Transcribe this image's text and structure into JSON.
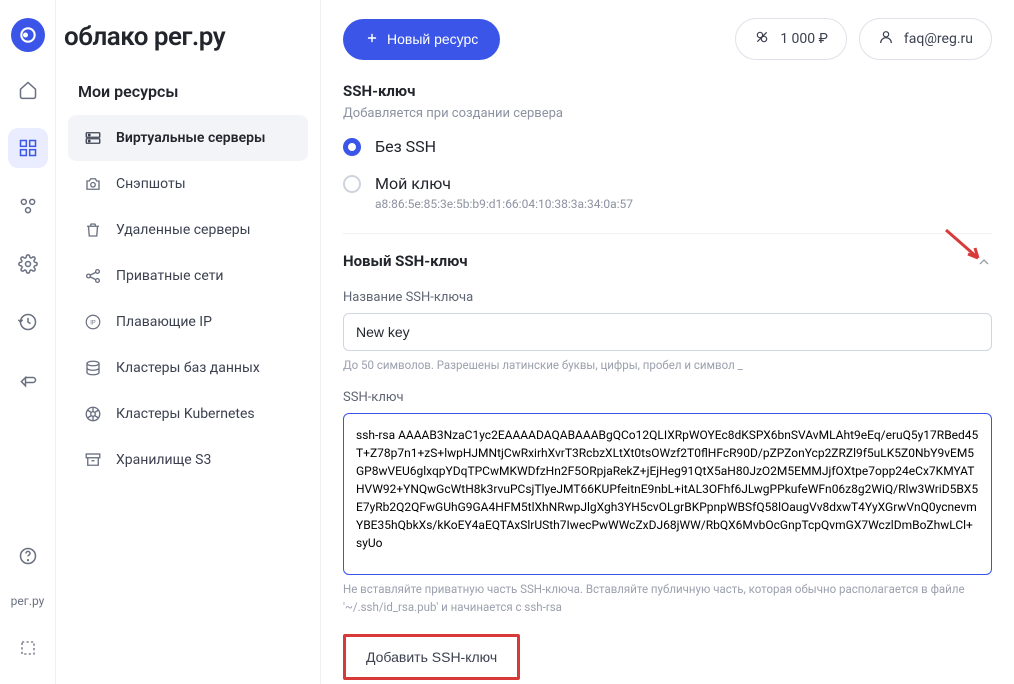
{
  "brand": "облако рег.ру",
  "section_title": "Мои ресурсы",
  "nav": {
    "servers": "Виртуальные серверы",
    "snapshots": "Снэпшоты",
    "deleted": "Удаленные серверы",
    "networks": "Приватные сети",
    "floating_ip": "Плавающие IP",
    "db": "Кластеры баз данных",
    "k8s": "Кластеры Kubernetes",
    "s3": "Хранилище S3"
  },
  "topbar": {
    "new_resource": "Новый ресурс",
    "balance": "1 000 ₽",
    "email": "faq@reg.ru"
  },
  "rail_footer": "рег.ру",
  "ssh": {
    "title": "SSH-ключ",
    "subtitle": "Добавляется при создании сервера",
    "option_none": "Без SSH",
    "option_mykey": "Мой ключ",
    "fingerprint": "a8:86:5e:85:3e:5b:b9:d1:66:04:10:38:3a:34:0a:57"
  },
  "new_key": {
    "heading": "Новый SSH-ключ",
    "name_label": "Название SSH-ключа",
    "name_value": "New key",
    "name_helper": "До 50 символов. Разрешены латинские буквы, цифры, пробел и символ _",
    "key_label": "SSH-ключ",
    "key_value": "ssh-rsa AAAAB3NzaC1yc2EAAAADAQABAAABgQCo12QLIXRpWOYEc8dKSPX6bnSVAvMLAht9eEq/eruQ5y17RBed45T+Z78p7n1+zS+lwpHJMNtjCwRxirhXvrT3RcbzXLtXt0tsOWzf2T0flHFcR90D/pZPZonYcp2ZRZl9f5uLK5Z0NbY9vEM5GP8wVEU6glxqpYDqTPCwMKWDfzHn2F5ORpjaRekZ+jEjHeg91QtX5aH80JzO2M5EMMJjfOXtpe7opp24eCx7KMYATHVW92+YNQwGcWtH8k3rvuPCsjTlyeJMT66KUPfeitnE9nbL+itAL3OFhf6JLwgPPkufeWFn06z8g2WiQ/Rlw3WriD5BX5E7yRb2Q2QFwGUhG9GA4HFM5tlXhNRwpJlgXgh3YH5cvOLgrBKPpnpWBSfQ58lOaugVv8dxwT4YyXGrwVnQ0ycnevmYBE35hQbkXs/kKoEY4aEQTAxSlrUSth7IwecPwWWcZxDJ68jWW/RbQX6MvbOcGnpTcpQvmGX7WczlDmBoZhwLCl+syUo",
    "key_helper": "Не вставляйте приватную часть SSH-ключа. Вставляйте публичную часть, которая обычно располагается в файле '~/.ssh/id_rsa.pub' и начинается с ssh-rsa",
    "add_button": "Добавить SSH-ключ"
  }
}
